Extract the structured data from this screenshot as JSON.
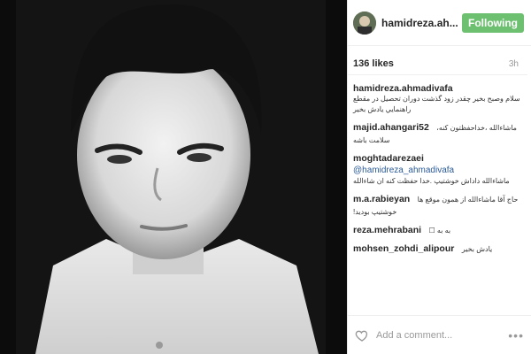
{
  "post": {
    "username": "hamidreza.ah...",
    "follow_label": "Following",
    "likes": "136 likes",
    "time": "3h"
  },
  "comments": [
    {
      "user": "hamidreza.ahmadivafa",
      "text": "سلام وصبح بخير چقدر زود گذشت دوران تحصيل در مقطع راهنمايي يادش بخير"
    },
    {
      "user": "majid.ahangari52",
      "text": "ماشاءالله ،خداحفظتون كنه، سلامت باشه"
    },
    {
      "user": "moghtadarezaei",
      "mention": "@hamidreza_ahmadivafa",
      "text": "ماشاءالله داداش خوشتيپ .خدا حفظت كنه ان شاءالله"
    },
    {
      "user": "m.a.rabieyan",
      "text": "حاج آقا ماشاءالله از همون موقع ها خوشتيپ بوديد!"
    },
    {
      "user": "reza.mehrabani",
      "text": "به به ☐"
    },
    {
      "user": "mohsen_zohdi_alipour",
      "text": "يادش بخير"
    }
  ],
  "footer": {
    "add_comment": "Add a comment...",
    "more": "•••"
  }
}
